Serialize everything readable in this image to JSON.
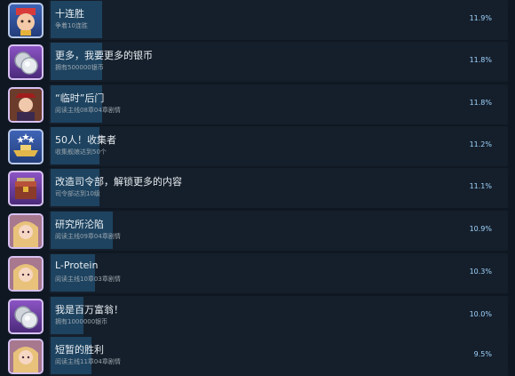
{
  "achievements": [
    {
      "title": "十连胜",
      "description": "争着10连胜",
      "percent": "11.9%",
      "percent_value": 11.9,
      "icon": "medal-face-icon",
      "frame": "blue"
    },
    {
      "title": "更多，我要更多的银币",
      "description": "拥有500000银币",
      "percent": "11.8%",
      "percent_value": 11.8,
      "icon": "silver-coin-icon",
      "frame": "purple"
    },
    {
      "title": "“临时”后门",
      "description": "阅读主线08章04章剧情",
      "percent": "11.8%",
      "percent_value": 11.8,
      "icon": "captain-portrait-icon",
      "frame": "purple"
    },
    {
      "title": "50人！收集者",
      "description": "收集舰娘达到50个",
      "percent": "11.2%",
      "percent_value": 11.2,
      "icon": "warship-stars-icon",
      "frame": "blue"
    },
    {
      "title": "改造司令部，解锁更多的内容",
      "description": "司令部达到10级",
      "percent": "11.1%",
      "percent_value": 11.1,
      "icon": "headquarters-chest-icon",
      "frame": "purple"
    },
    {
      "title": "研究所沦陷",
      "description": "阅读主线09章04章剧情",
      "percent": "10.9%",
      "percent_value": 10.9,
      "icon": "blonde-girl-portrait-icon",
      "frame": "purple"
    },
    {
      "title": "L-Protein",
      "description": "阅读主线10章03章剧情",
      "percent": "10.3%",
      "percent_value": 10.3,
      "icon": "blonde-girl-portrait-icon",
      "frame": "purple"
    },
    {
      "title": "我是百万富翁！",
      "description": "拥有1000000银币",
      "percent": "10.0%",
      "percent_value": 10.0,
      "icon": "silver-coin-icon",
      "frame": "purple"
    },
    {
      "title": "短暂的胜利",
      "description": "阅读主线11章04章剧情",
      "percent": "9.5%",
      "percent_value": 9.5,
      "icon": "blonde-girl-portrait-icon",
      "frame": "purple"
    }
  ],
  "colors": {
    "background": "#0f1822",
    "row_background": "#151f2b",
    "bar": "#1f4a6a",
    "percent_text": "#9fd4ff"
  }
}
